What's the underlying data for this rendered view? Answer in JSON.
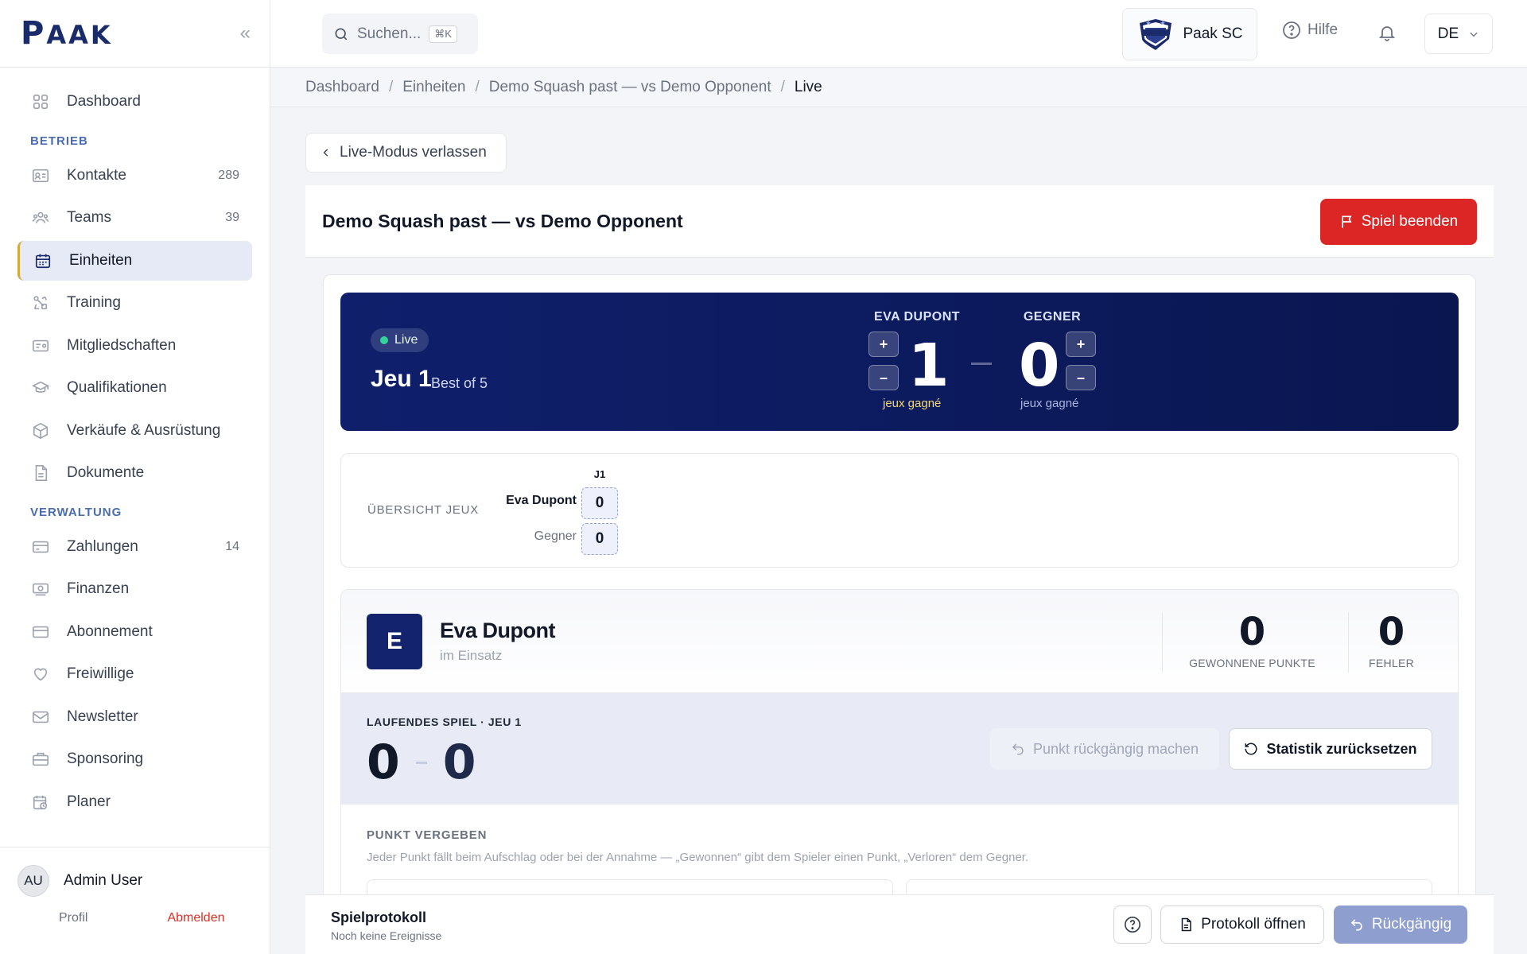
{
  "sidebar": {
    "logo_big": "P",
    "logo_small": "AAK",
    "sections": {
      "ops": "BETRIEB",
      "admin": "VERWALTUNG"
    },
    "items": [
      {
        "label": "Dashboard",
        "count": "",
        "icon": "grid-icon"
      },
      {
        "label": "Kontakte",
        "count": "289",
        "icon": "contact-card-icon"
      },
      {
        "label": "Teams",
        "count": "39",
        "icon": "users-icon"
      },
      {
        "label": "Einheiten",
        "count": "",
        "icon": "calendar-icon"
      },
      {
        "label": "Training",
        "count": "",
        "icon": "training-icon"
      },
      {
        "label": "Mitgliedschaften",
        "count": "",
        "icon": "membership-card-icon"
      },
      {
        "label": "Qualifikationen",
        "count": "",
        "icon": "graduation-cap-icon"
      },
      {
        "label": "Verkäufe & Ausrüstung",
        "count": "",
        "icon": "box-icon"
      },
      {
        "label": "Dokumente",
        "count": "",
        "icon": "document-icon"
      },
      {
        "label": "Zahlungen",
        "count": "14",
        "icon": "payment-card-icon"
      },
      {
        "label": "Finanzen",
        "count": "",
        "icon": "money-icon"
      },
      {
        "label": "Abonnement",
        "count": "",
        "icon": "credit-card-icon"
      },
      {
        "label": "Freiwillige",
        "count": "",
        "icon": "heart-icon"
      },
      {
        "label": "Newsletter",
        "count": "",
        "icon": "mail-icon"
      },
      {
        "label": "Sponsoring",
        "count": "",
        "icon": "briefcase-icon"
      },
      {
        "label": "Planer",
        "count": "",
        "icon": "calendar-clock-icon"
      }
    ],
    "user": {
      "initials": "AU",
      "name": "Admin User",
      "profile": "Profil",
      "logout": "Abmelden"
    }
  },
  "topbar": {
    "search_placeholder": "Suchen...",
    "search_shortcut": "⌘K",
    "club_name": "Paak SC",
    "help": "Hilfe",
    "language": "DE"
  },
  "breadcrumb": [
    "Dashboard",
    "Einheiten",
    "Demo Squash past — vs Demo Opponent",
    "Live"
  ],
  "main": {
    "leave_live": "Live-Modus verlassen",
    "title": "Demo Squash past — vs Demo Opponent",
    "end_game": "Spiel beenden",
    "scoreboard": {
      "live": "Live",
      "game": "Jeu 1",
      "best_of": "Best of 5",
      "player1": {
        "name": "EVA DUPONT",
        "score": "1",
        "sub": "jeux gagné"
      },
      "player2": {
        "name": "GEGNER",
        "score": "0",
        "sub": "jeux gagné"
      },
      "plus": "+",
      "minus": "–"
    },
    "overview": {
      "label": "ÜBERSICHT JEUX",
      "column": "J1",
      "player1": "Eva Dupont",
      "player2": "Gegner",
      "score1": "0",
      "score2": "0"
    },
    "player_card": {
      "initial": "E",
      "name": "Eva Dupont",
      "status": "im Einsatz",
      "points_won": "0",
      "points_won_label": "GEWONNENE PUNKTE",
      "errors": "0",
      "errors_label": "FEHLER",
      "running_label": "LAUFENDES SPIEL · JEU 1",
      "running_score1": "0",
      "running_score2": "0",
      "undo_point": "Punkt rückgängig machen",
      "reset_stats": "Statistik zurücksetzen",
      "award_label": "PUNKT VERGEBEN",
      "award_desc": "Jeder Punkt fällt beim Aufschlag oder bei der Annahme — „Gewonnen“ gibt dem Spieler einen Punkt, „Verloren“ dem Gegner."
    }
  },
  "bottombar": {
    "title": "Spielprotokoll",
    "subtitle": "Noch keine Ereignisse",
    "open_protocol": "Protokoll öffnen",
    "undo": "Rückgängig"
  },
  "colors": {
    "brand": "#1a2b6b",
    "accent": "#d4a93a",
    "danger": "#dc2626",
    "scoreboard": "#0f1f6b",
    "live": "#34d399"
  }
}
